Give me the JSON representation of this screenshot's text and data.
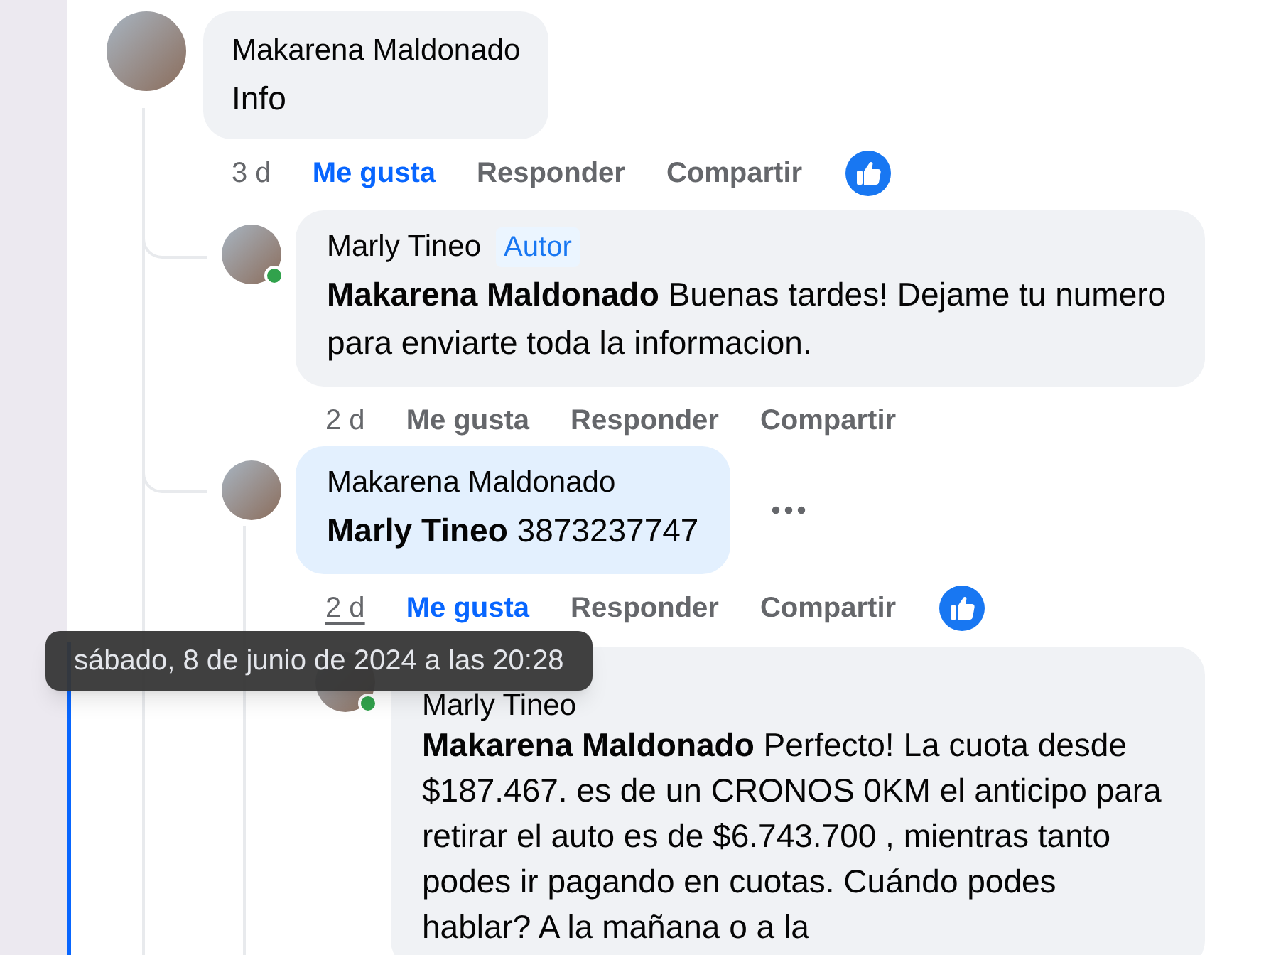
{
  "comments": [
    {
      "author": "Makarena Maldonado",
      "online": false,
      "text": "Info",
      "highlighted": false,
      "time": "3 d",
      "time_hovered": false,
      "like_label": "Me gusta",
      "liked": true,
      "reply_label": "Responder",
      "share_label": "Compartir",
      "reaction_shown": true,
      "more_shown": false,
      "children": [
        {
          "author": "Marly Tineo",
          "badge": "Autor",
          "online": true,
          "text": "**Makarena Maldonado** Buenas tardes! Dejame tu numero para enviarte toda la informacion.",
          "highlighted": false,
          "time": "2 d",
          "time_hovered": false,
          "like_label": "Me gusta",
          "liked": false,
          "reply_label": "Responder",
          "share_label": "Compartir",
          "reaction_shown": false,
          "more_shown": false
        },
        {
          "author": "Makarena Maldonado",
          "online": false,
          "text": "**Marly Tineo** 3873237747",
          "highlighted": true,
          "time": "2 d",
          "time_hovered": true,
          "like_label": "Me gusta",
          "liked": true,
          "reply_label": "Responder",
          "share_label": "Compartir",
          "reaction_shown": true,
          "more_shown": true,
          "children": [
            {
              "author": "Marly Tineo",
              "online": true,
              "text": "**Makarena Maldonado** Perfecto! La cuota desde $187.467. es de un CRONOS 0KM el anticipo para retirar el auto es de $6.743.700 , mientras tanto podes ir pagando en cuotas. Cuándo podes hablar? A la mañana o a la",
              "highlighted": false
            }
          ]
        }
      ]
    }
  ],
  "tooltip": {
    "text": "sábado, 8 de junio de 2024 a las 20:28"
  }
}
